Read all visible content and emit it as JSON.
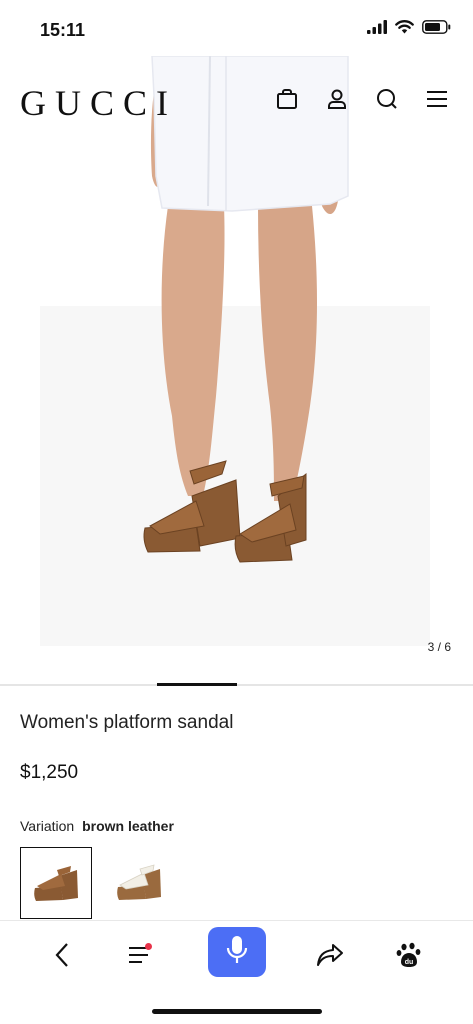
{
  "status_bar": {
    "time": "15:11"
  },
  "header": {
    "logo": "GUCCI"
  },
  "gallery": {
    "counter": "3 / 6",
    "current": 3,
    "total": 6
  },
  "product": {
    "title": "Women's platform sandal",
    "price": "$1,250",
    "variation_label": "Variation",
    "variation_value": "brown leather"
  },
  "colors": {
    "accent": "#4c6ef5",
    "badge": "#e8334a",
    "sandal": "#8a5a33"
  }
}
